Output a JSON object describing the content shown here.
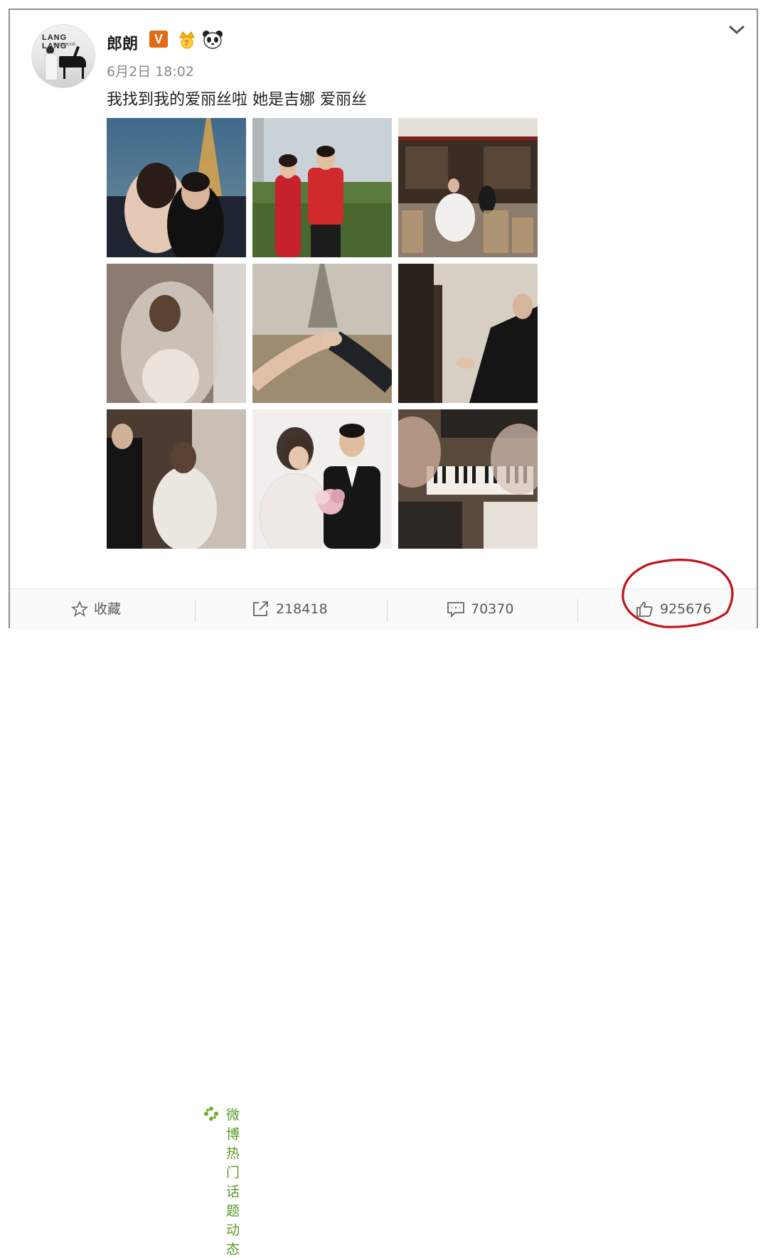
{
  "post": {
    "author": "郎朗",
    "verified_badge": "V",
    "timestamp": "6月2日 18:02",
    "content": "我找到我的爱丽丝啦 她是吉娜 爱丽丝",
    "avatar_text": "LANG LANG",
    "avatar_subtext": "PIANO BOOK",
    "topic_link": "微博热门话题动态",
    "photo_count": 9
  },
  "actions": {
    "favorite_label": "收藏",
    "repost_count": "218418",
    "comment_count": "70370",
    "like_count": "925676"
  },
  "icons": {
    "favorite": "star-icon",
    "repost": "share-arrow-icon",
    "comment": "comment-icon",
    "like": "thumbs-up-icon",
    "more": "chevron-down-icon",
    "topic": "topic-icon"
  },
  "colors": {
    "badge": "#e06b12",
    "topic": "#5a9a2a",
    "annotation_circle": "#c0141c"
  }
}
